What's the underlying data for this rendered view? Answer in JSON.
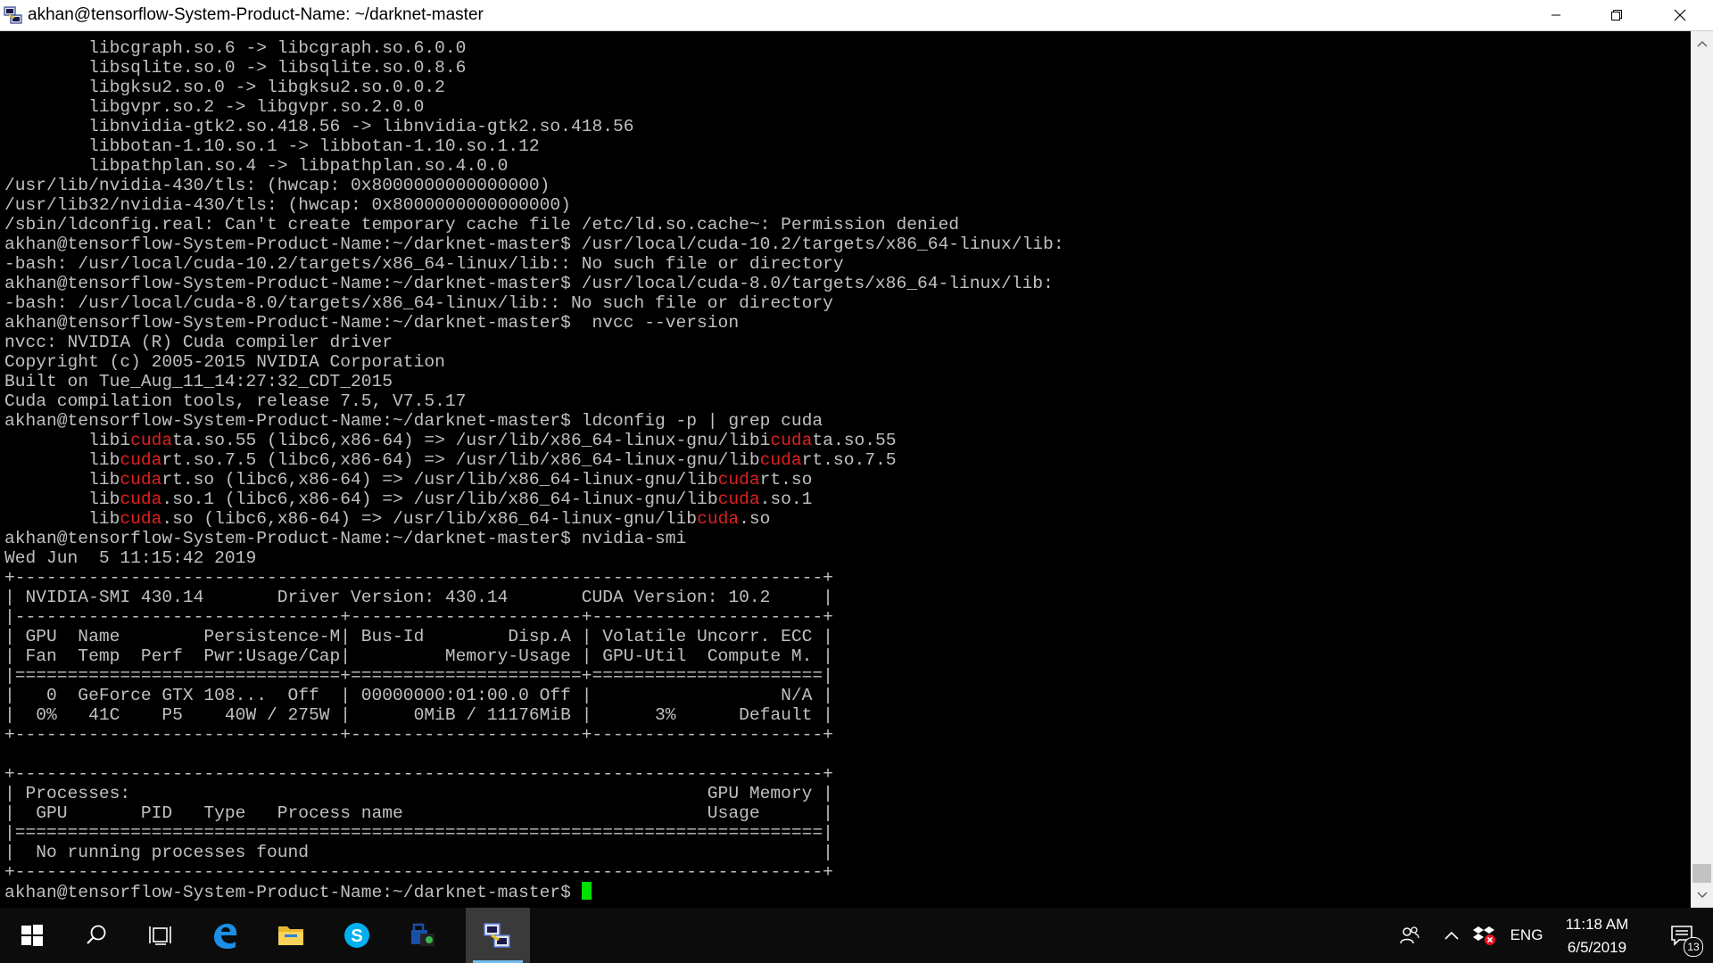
{
  "window": {
    "title": "akhan@tensorflow-System-Product-Name: ~/darknet-master"
  },
  "terminal": {
    "lines": [
      [
        {
          "t": "        libcgraph.so.6 -> libcgraph.so.6.0.0"
        }
      ],
      [
        {
          "t": "        libsqlite.so.0 -> libsqlite.so.0.8.6"
        }
      ],
      [
        {
          "t": "        libgksu2.so.0 -> libgksu2.so.0.0.2"
        }
      ],
      [
        {
          "t": "        libgvpr.so.2 -> libgvpr.so.2.0.0"
        }
      ],
      [
        {
          "t": "        libnvidia-gtk2.so.418.56 -> libnvidia-gtk2.so.418.56"
        }
      ],
      [
        {
          "t": "        libbotan-1.10.so.1 -> libbotan-1.10.so.1.12"
        }
      ],
      [
        {
          "t": "        libpathplan.so.4 -> libpathplan.so.4.0.0"
        }
      ],
      [
        {
          "t": "/usr/lib/nvidia-430/tls: (hwcap: 0x8000000000000000)"
        }
      ],
      [
        {
          "t": "/usr/lib32/nvidia-430/tls: (hwcap: 0x8000000000000000)"
        }
      ],
      [
        {
          "t": "/sbin/ldconfig.real: Can't create temporary cache file /etc/ld.so.cache~: Permission denied"
        }
      ],
      [
        {
          "t": "akhan@tensorflow-System-Product-Name:~/darknet-master$ /usr/local/cuda-10.2/targets/x86_64-linux/lib:"
        }
      ],
      [
        {
          "t": "-bash: /usr/local/cuda-10.2/targets/x86_64-linux/lib:: No such file or directory"
        }
      ],
      [
        {
          "t": "akhan@tensorflow-System-Product-Name:~/darknet-master$ /usr/local/cuda-8.0/targets/x86_64-linux/lib:"
        }
      ],
      [
        {
          "t": "-bash: /usr/local/cuda-8.0/targets/x86_64-linux/lib:: No such file or directory"
        }
      ],
      [
        {
          "t": "akhan@tensorflow-System-Product-Name:~/darknet-master$  nvcc --version"
        }
      ],
      [
        {
          "t": "nvcc: NVIDIA (R) Cuda compiler driver"
        }
      ],
      [
        {
          "t": "Copyright (c) 2005-2015 NVIDIA Corporation"
        }
      ],
      [
        {
          "t": "Built on Tue_Aug_11_14:27:32_CDT_2015"
        }
      ],
      [
        {
          "t": "Cuda compilation tools, release 7.5, V7.5.17"
        }
      ],
      [
        {
          "t": "akhan@tensorflow-System-Product-Name:~/darknet-master$ ldconfig -p | grep cuda"
        }
      ],
      [
        {
          "t": "        libi"
        },
        {
          "t": "cuda",
          "hl": true
        },
        {
          "t": "ta.so.55 (libc6,x86-64) => /usr/lib/x86_64-linux-gnu/libi"
        },
        {
          "t": "cuda",
          "hl": true
        },
        {
          "t": "ta.so.55"
        }
      ],
      [
        {
          "t": "        lib"
        },
        {
          "t": "cuda",
          "hl": true
        },
        {
          "t": "rt.so.7.5 (libc6,x86-64) => /usr/lib/x86_64-linux-gnu/lib"
        },
        {
          "t": "cuda",
          "hl": true
        },
        {
          "t": "rt.so.7.5"
        }
      ],
      [
        {
          "t": "        lib"
        },
        {
          "t": "cuda",
          "hl": true
        },
        {
          "t": "rt.so (libc6,x86-64) => /usr/lib/x86_64-linux-gnu/lib"
        },
        {
          "t": "cuda",
          "hl": true
        },
        {
          "t": "rt.so"
        }
      ],
      [
        {
          "t": "        lib"
        },
        {
          "t": "cuda",
          "hl": true
        },
        {
          "t": ".so.1 (libc6,x86-64) => /usr/lib/x86_64-linux-gnu/lib"
        },
        {
          "t": "cuda",
          "hl": true
        },
        {
          "t": ".so.1"
        }
      ],
      [
        {
          "t": "        lib"
        },
        {
          "t": "cuda",
          "hl": true
        },
        {
          "t": ".so (libc6,x86-64) => /usr/lib/x86_64-linux-gnu/lib"
        },
        {
          "t": "cuda",
          "hl": true
        },
        {
          "t": ".so"
        }
      ],
      [
        {
          "t": "akhan@tensorflow-System-Product-Name:~/darknet-master$ nvidia-smi"
        }
      ],
      [
        {
          "t": "Wed Jun  5 11:15:42 2019"
        }
      ],
      [
        {
          "t": "+-----------------------------------------------------------------------------+"
        }
      ],
      [
        {
          "t": "| NVIDIA-SMI 430.14       Driver Version: 430.14       CUDA Version: 10.2     |"
        }
      ],
      [
        {
          "t": "|-------------------------------+----------------------+----------------------+"
        }
      ],
      [
        {
          "t": "| GPU  Name        Persistence-M| Bus-Id        Disp.A | Volatile Uncorr. ECC |"
        }
      ],
      [
        {
          "t": "| Fan  Temp  Perf  Pwr:Usage/Cap|         Memory-Usage | GPU-Util  Compute M. |"
        }
      ],
      [
        {
          "t": "|===============================+======================+======================|"
        }
      ],
      [
        {
          "t": "|   0  GeForce GTX 108...  Off  | 00000000:01:00.0 Off |                  N/A |"
        }
      ],
      [
        {
          "t": "|  0%   41C    P5    40W / 275W |      0MiB / 11176MiB |      3%      Default |"
        }
      ],
      [
        {
          "t": "+-------------------------------+----------------------+----------------------+"
        }
      ],
      [
        {
          "t": ""
        }
      ],
      [
        {
          "t": "+-----------------------------------------------------------------------------+"
        }
      ],
      [
        {
          "t": "| Processes:                                                       GPU Memory |"
        }
      ],
      [
        {
          "t": "|  GPU       PID   Type   Process name                             Usage      |"
        }
      ],
      [
        {
          "t": "|=============================================================================|"
        }
      ],
      [
        {
          "t": "|  No running processes found                                                 |"
        }
      ],
      [
        {
          "t": "+-----------------------------------------------------------------------------+"
        }
      ],
      [
        {
          "t": "akhan@tensorflow-System-Product-Name:~/darknet-master$ "
        },
        {
          "cursor": true
        }
      ]
    ]
  },
  "taskbar": {
    "apps": [
      "start-icon",
      "search-icon",
      "task-view-icon",
      "edge-icon",
      "file-explorer-icon",
      "skype-icon",
      "store-icon",
      "putty-icon"
    ],
    "tray": {
      "language": "ENG",
      "time": "11:18 AM",
      "date": "6/5/2019",
      "notifications": "13"
    }
  },
  "colors": {
    "terminal_bg": "#000000",
    "terminal_fg": "#c0c0c0",
    "highlight": "#e02020",
    "cursor": "#00e000",
    "taskbar_bg": "#0c0c0c",
    "active_app": "#3a3a3a"
  }
}
